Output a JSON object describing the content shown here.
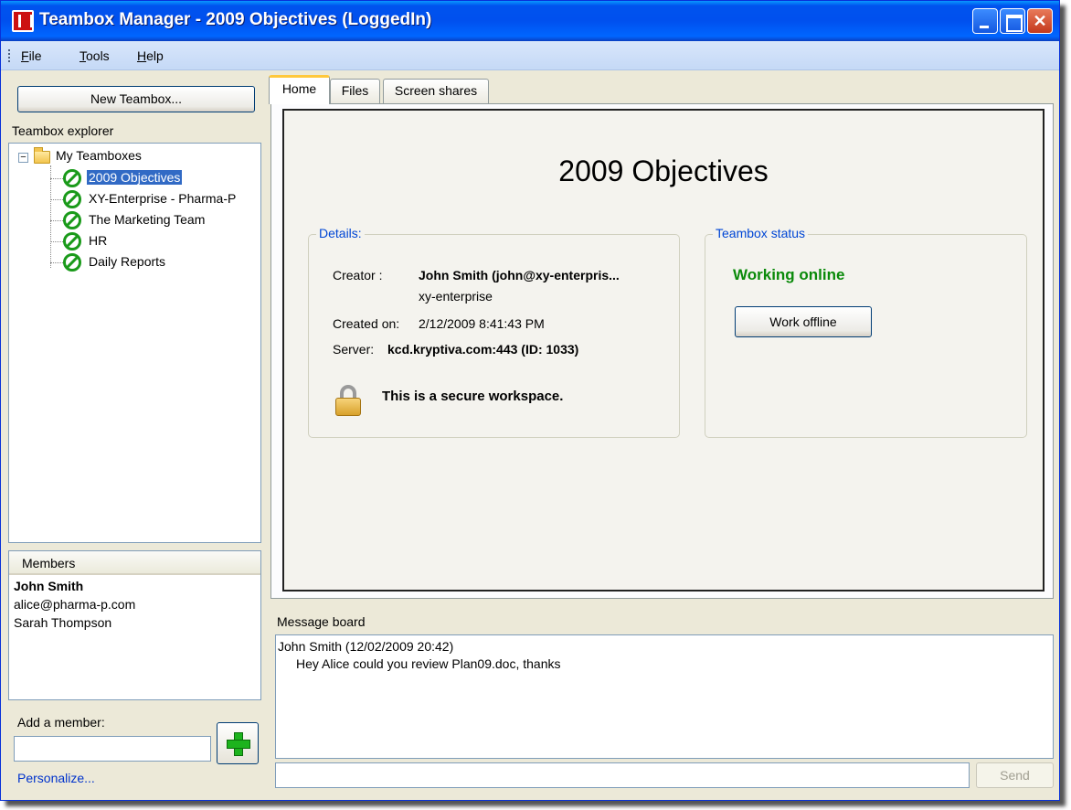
{
  "window": {
    "title": "Teambox Manager - 2009 Objectives (LoggedIn)"
  },
  "menu": {
    "items": [
      "File",
      "Tools",
      "Help"
    ]
  },
  "left_panel": {
    "new_teambox_label": "New Teambox...",
    "explorer_label": "Teambox explorer",
    "tree": {
      "root_label": "My Teamboxes",
      "root_toggle": "−",
      "items": [
        {
          "label": "2009 Objectives",
          "selected": true
        },
        {
          "label": "XY-Enterprise - Pharma-P",
          "selected": false
        },
        {
          "label": "The Marketing Team",
          "selected": false
        },
        {
          "label": "HR",
          "selected": false
        },
        {
          "label": "Daily Reports",
          "selected": false
        }
      ]
    },
    "members": {
      "header": "Members",
      "list": [
        "John Smith",
        "alice@pharma-p.com",
        "Sarah Thompson"
      ]
    },
    "add_member_label": "Add a member:",
    "add_member_value": "",
    "personalize_label": "Personalize..."
  },
  "tabs": [
    {
      "label": "Home",
      "active": true
    },
    {
      "label": "Files",
      "active": false
    },
    {
      "label": "Screen shares",
      "active": false
    }
  ],
  "home": {
    "title": "2009 Objectives",
    "details": {
      "legend": "Details:",
      "creator_key": "Creator :",
      "creator_value": "John Smith (john@xy-enterpris...",
      "creator_org": "xy-enterprise",
      "created_key": "Created on:",
      "created_value": "2/12/2009 8:41:43 PM",
      "server_key": "Server:",
      "server_value": "kcd.kryptiva.com:443 (ID: 1033)",
      "secure_text": "This is a secure workspace."
    },
    "status": {
      "legend": "Teambox status",
      "state": "Working online",
      "state_color": "#0a8a0a",
      "work_offline_label": "Work offline"
    }
  },
  "message_board": {
    "label": "Message board",
    "messages": [
      {
        "author": "John Smith (12/02/2009 20:42)",
        "text": "Hey Alice could you review Plan09.doc, thanks"
      }
    ],
    "input_value": "",
    "send_label": "Send"
  },
  "colors": {
    "titlebar": "#0053ee",
    "selection": "#316ac5",
    "legend": "#0046d5",
    "link": "#0033cc"
  }
}
